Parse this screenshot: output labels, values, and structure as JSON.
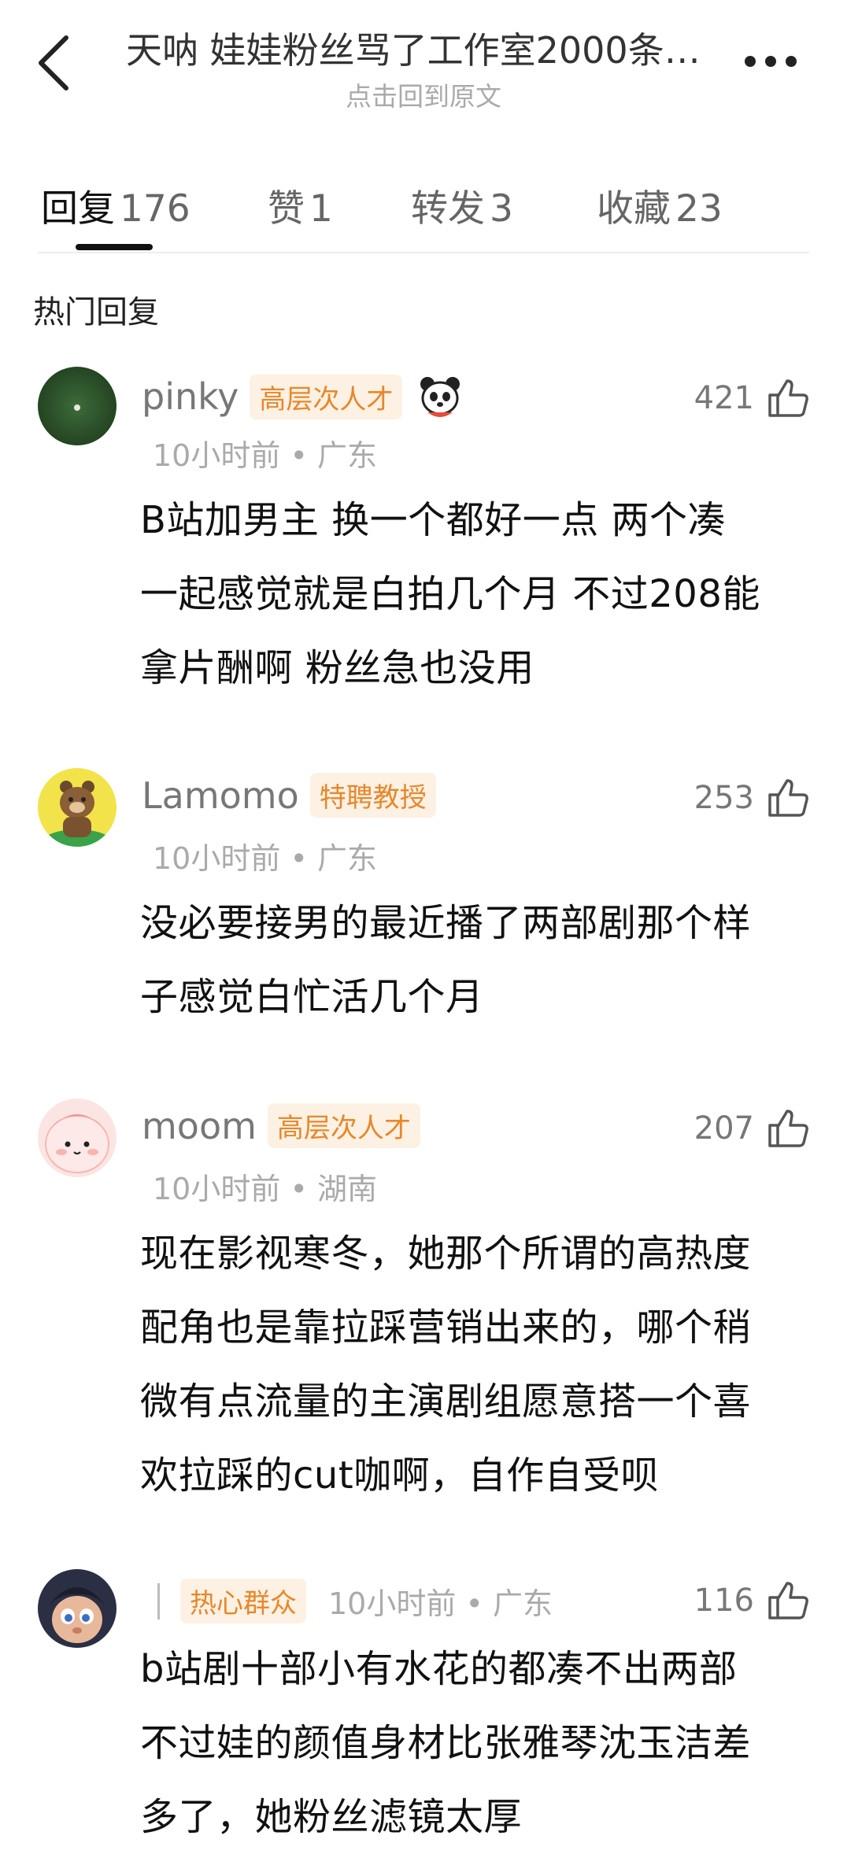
{
  "header": {
    "title": "天呐 娃娃粉丝骂了工作室2000条…",
    "subtitle": "点击回到原文"
  },
  "tabs": [
    {
      "label": "回复",
      "count": "176"
    },
    {
      "label": "赞",
      "count": "1"
    },
    {
      "label": "转发",
      "count": "3"
    },
    {
      "label": "收藏",
      "count": "23"
    }
  ],
  "section_title": "热门回复",
  "comments": [
    {
      "username": "pinky",
      "badge": "高层次人才",
      "time": "10小时前",
      "location": "广东",
      "likes": "421",
      "lines": [
        "B站加男主 换一个都好一点  两个凑",
        "一起感觉就是白拍几个月 不过208能",
        "拿片酬啊  粉丝急也没用"
      ]
    },
    {
      "username": "Lamomo",
      "badge": "特聘教授",
      "time": "10小时前",
      "location": "广东",
      "likes": "253",
      "lines": [
        "没必要接男的最近播了两部剧那个样",
        "子感觉白忙活几个月"
      ]
    },
    {
      "username": "moom",
      "badge": "高层次人才",
      "time": "10小时前",
      "location": "湖南",
      "likes": "207",
      "lines": [
        "现在影视寒冬，她那个所谓的高热度",
        "配角也是靠拉踩营销出来的，哪个稍",
        "微有点流量的主演剧组愿意搭一个喜",
        "欢拉踩的cut咖啊，自作自受呗"
      ]
    },
    {
      "username": "",
      "badge": "热心群众",
      "time": "10小时前",
      "location": "广东",
      "likes": "116",
      "lines": [
        "b站剧十部小有水花的都凑不出两部",
        "不过娃的颜值身材比张雅琴沈玉洁差",
        "多了，她粉丝滤镜太厚"
      ]
    }
  ],
  "colors": {
    "badge_text": "#e8872a",
    "badge_bg": "#fdf1e4",
    "accent": "#111111"
  }
}
